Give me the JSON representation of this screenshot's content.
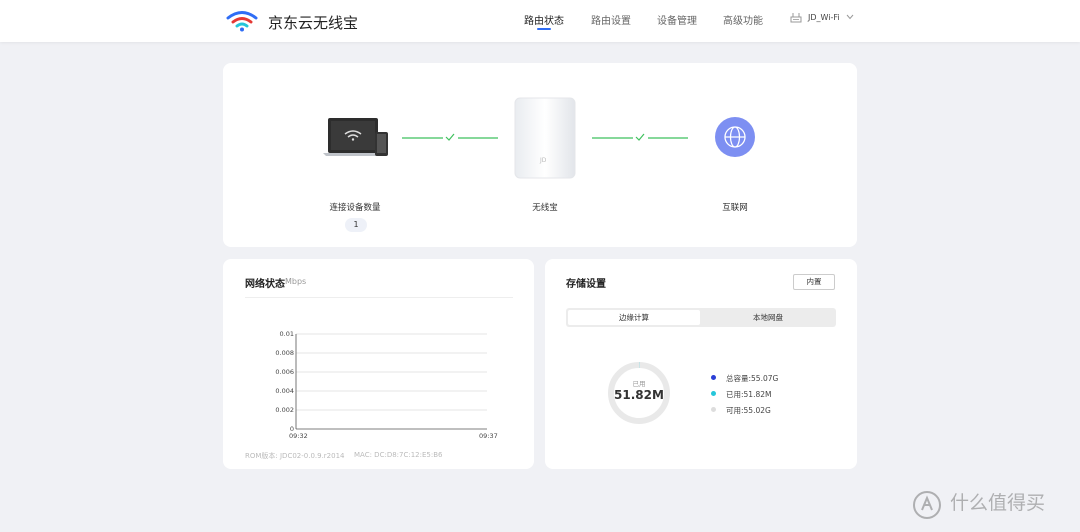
{
  "header": {
    "brand": "京东云无线宝",
    "nav": [
      "路由状态",
      "路由设置",
      "设备管理",
      "高级功能"
    ],
    "active_nav": "路由状态",
    "ssid": "JD_Wi-Fi",
    "colors": {
      "accent": "#2f6df5",
      "wifi_blue": "#2f6df5",
      "wifi_red": "#e53935",
      "wifi_teal": "#26c6da"
    }
  },
  "topology": {
    "devices_label": "连接设备数量",
    "devices_count": "1",
    "router_label": "无线宝",
    "internet_label": "互联网",
    "link_color": "#3fc15e",
    "globe_color": "#7d8ff2"
  },
  "network": {
    "title": "网络状态",
    "unit": "Mbps",
    "footer_rom": "ROM版本: JDC02-0.0.9.r2014",
    "footer_mac": "MAC: DC:D8:7C:12:E5:B6"
  },
  "chart_data": {
    "type": "line",
    "x": [
      "09:32",
      "09:37"
    ],
    "ylim": [
      0,
      0.01
    ],
    "yticks": [
      "0.01",
      "0.008",
      "0.006",
      "0.004",
      "0.002",
      "0"
    ],
    "xticks": [
      "09:32",
      "09:37"
    ],
    "series": [],
    "grid": true
  },
  "storage": {
    "title": "存储设置",
    "builtin_button": "内置",
    "tabs": [
      "边缘计算",
      "本地网盘"
    ],
    "active_tab": "边缘计算",
    "ring_label": "已用",
    "ring_value": "51.82M",
    "used_fraction": 0.001,
    "legend": [
      {
        "text": "总容量:55.07G",
        "color": "#2b3fd6"
      },
      {
        "text": "已用:51.82M",
        "color": "#26c6da"
      },
      {
        "text": "可用:55.02G",
        "color": "#dddddd"
      }
    ]
  },
  "watermark": "什么值得买"
}
